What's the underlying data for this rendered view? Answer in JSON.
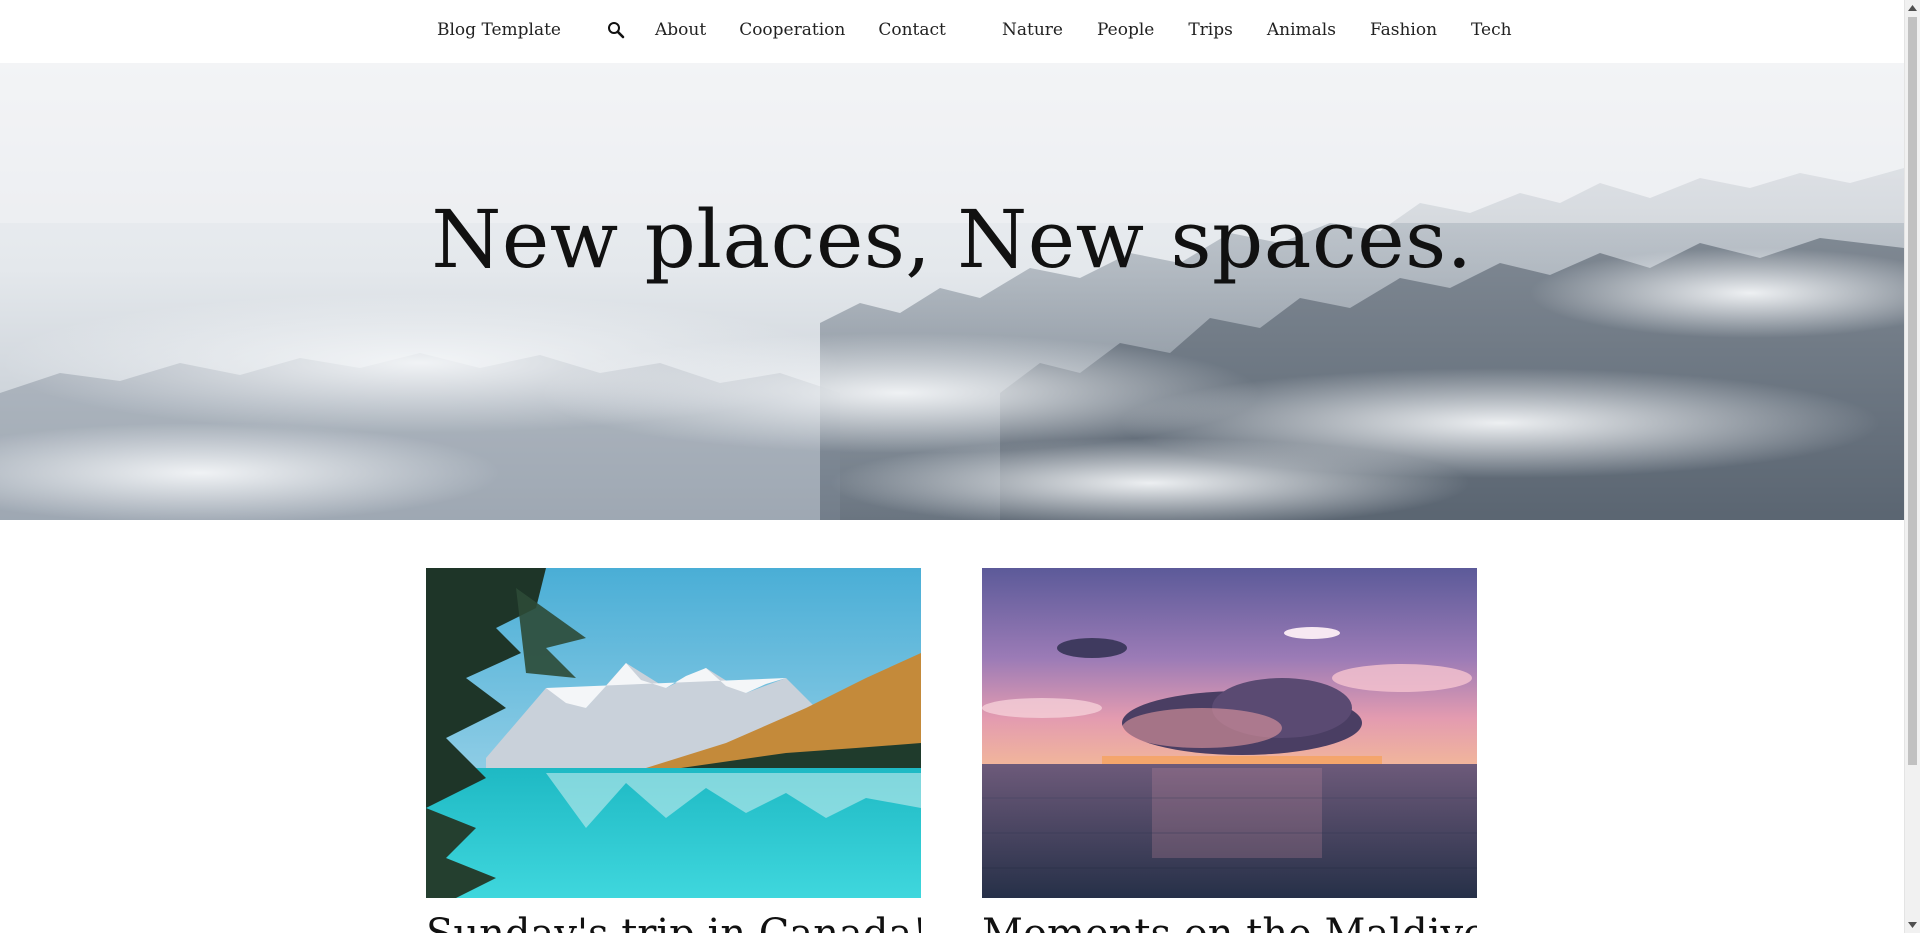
{
  "header": {
    "brand": "Blog Template",
    "search_icon": "search-icon",
    "nav_left": [
      "About",
      "Cooperation",
      "Contact"
    ],
    "nav_right": [
      "Nature",
      "People",
      "Trips",
      "Animals",
      "Fashion",
      "Tech"
    ]
  },
  "hero": {
    "title": "New places, New spaces.",
    "image": "misty forest"
  },
  "posts": [
    {
      "image": "turquoise mountain lake",
      "title": "Sunday's trip in Canada! The"
    },
    {
      "image": "ocean sunset",
      "title": "Moments on the Maldives & Hawaii"
    }
  ],
  "colors": {
    "text": "#1a1a1a",
    "background": "#ffffff",
    "lake": "#2fc4c9",
    "sky_purple": "#8a72a8",
    "sunset_pink": "#f0a0a6"
  }
}
